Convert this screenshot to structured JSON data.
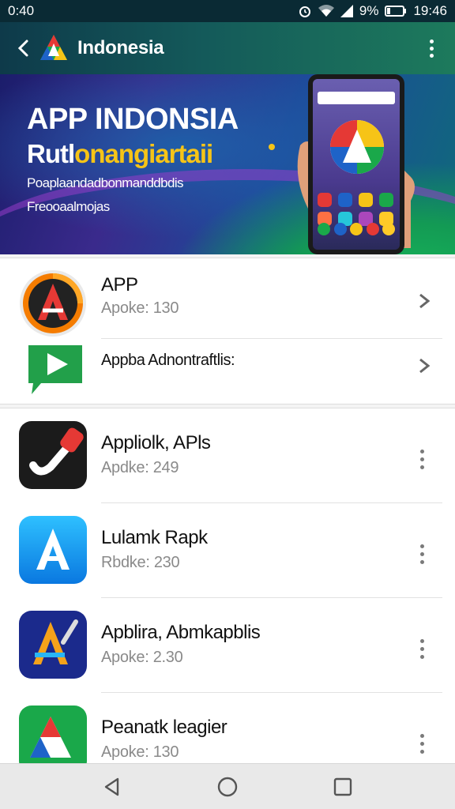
{
  "status_bar": {
    "time_left": "0:40",
    "battery": "9%",
    "time_right": "19:46"
  },
  "app_bar": {
    "title": "Indonesia"
  },
  "banner": {
    "title": "APP INDONSIA",
    "subtitle_white": "Rutl",
    "subtitle_yellow": "onangiartaii",
    "line1": "Poaplaandadbonmanddbdis",
    "line2": "Freooaalmojas"
  },
  "featured": [
    {
      "name": "APP",
      "meta": "Apoke: 130"
    },
    {
      "name": "Appba Adnontraftlis:",
      "meta": ""
    }
  ],
  "apps": [
    {
      "name": "Appliolk, APls",
      "meta": "Apdke: 249"
    },
    {
      "name": "Lulamk Rapk",
      "meta": "Rbdke: 230"
    },
    {
      "name": "Apblira, Abmkapblis",
      "meta": "Apoke: 2.30"
    },
    {
      "name": "Peanatk leagier",
      "meta": "Apoke: 130"
    }
  ],
  "colors": {
    "brand_green": "#18b85a",
    "brand_blue": "#1f5ea8",
    "accent_yellow": "#f6c417"
  }
}
